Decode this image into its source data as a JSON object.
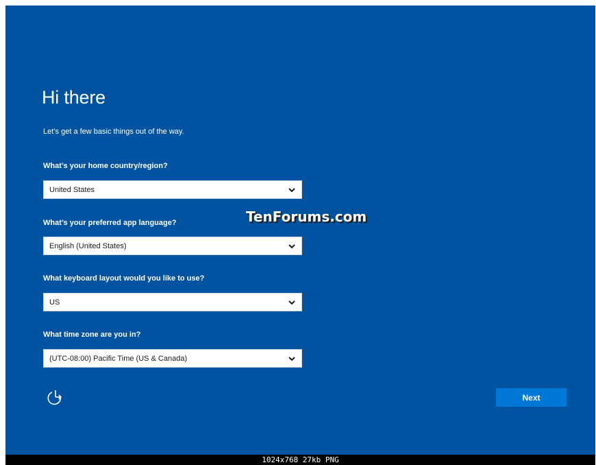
{
  "setup": {
    "title": "Hi there",
    "subtitle": "Let’s get a few basic things out of the way.",
    "questions": [
      {
        "label": "What’s your home country/region?",
        "value": "United States"
      },
      {
        "label": "What’s your preferred app language?",
        "value": "English (United States)"
      },
      {
        "label": "What keyboard layout would you like to use?",
        "value": "US"
      },
      {
        "label": "What time zone are you in?",
        "value": "(UTC-08:00) Pacific Time (US & Canada)"
      }
    ],
    "next_label": "Next",
    "ease_of_access_icon": "ease-of-access-icon",
    "dropdown_icon": "chevron-down-icon"
  },
  "watermark": "TenForums.com",
  "image_info": "1024x768  27kb  PNG",
  "colors": {
    "background": "#0053a0",
    "button": "#0078d7",
    "text": "#ffffff"
  }
}
